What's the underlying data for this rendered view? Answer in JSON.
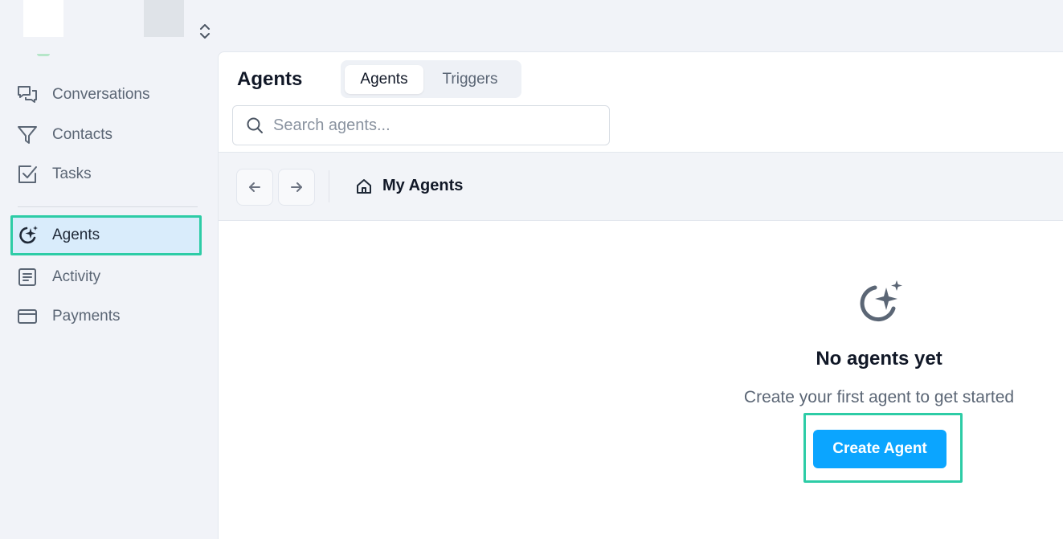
{
  "sidebar": {
    "items": [
      {
        "label": "Conversations",
        "icon": "chat-bubbles-icon"
      },
      {
        "label": "Contacts",
        "icon": "filter-funnel-icon"
      },
      {
        "label": "Tasks",
        "icon": "checkbox-icon"
      },
      {
        "label": "Agents",
        "icon": "agent-sparkle-icon",
        "active": true
      },
      {
        "label": "Activity",
        "icon": "document-list-icon"
      },
      {
        "label": "Payments",
        "icon": "credit-card-icon"
      }
    ]
  },
  "main": {
    "title": "Agents",
    "tabs": [
      {
        "label": "Agents",
        "active": true
      },
      {
        "label": "Triggers",
        "active": false
      }
    ],
    "search": {
      "placeholder": "Search agents..."
    },
    "breadcrumb": {
      "label": "My Agents"
    },
    "empty_state": {
      "title": "No agents yet",
      "subtitle": "Create your first agent to get started",
      "button": "Create Agent"
    }
  },
  "colors": {
    "accent": "#0ba5ff",
    "highlight_border": "#2dcca6",
    "active_bg": "#d9ecfb"
  }
}
